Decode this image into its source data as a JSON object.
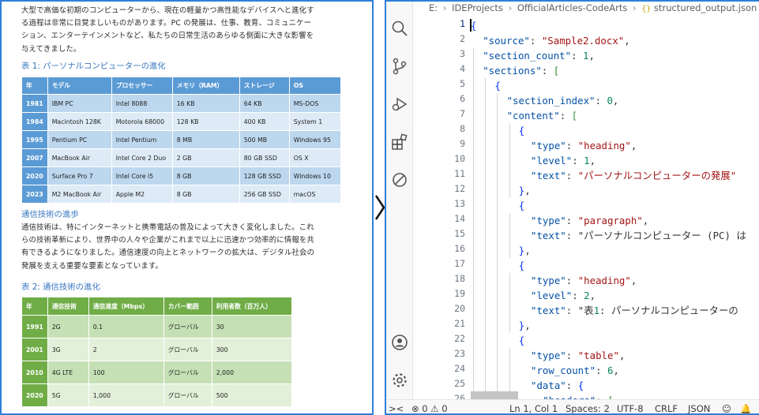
{
  "document": {
    "intro_lines": [
      "大型で高価な初期のコンピューターから、現在の軽量かつ高性能なデバイスへと進化す",
      "る過程は非常に目覚ましいものがあります。PC の発展は、仕事、教育、コミュニケー",
      "ション、エンターテインメントなど、私たちの日常生活のあらゆる側面に大きな影響を",
      "与えてきました。"
    ],
    "table1_caption": "表 1:  パーソナルコンピューターの進化",
    "table1": {
      "headers": [
        "年",
        "モデル",
        "プロセッサー",
        "メモリ（RAM）",
        "ストレージ",
        "OS"
      ],
      "rows": [
        [
          "1981",
          "IBM PC",
          "Intel 8088",
          "16 KB",
          "64 KB",
          "MS-DOS"
        ],
        [
          "1984",
          "Macintosh 128K",
          "Motorola 68000",
          "128 KB",
          "400 KB",
          "System 1"
        ],
        [
          "1995",
          "Pentium PC",
          "Intel Pentium",
          "8 MB",
          "500 MB",
          "Windows 95"
        ],
        [
          "2007",
          "MacBook Air",
          "Intel Core 2 Duo",
          "2 GB",
          "80 GB SSD",
          "OS X"
        ],
        [
          "2020",
          "Surface Pro 7",
          "Intel Core i5",
          "8 GB",
          "128 GB SSD",
          "Windows 10"
        ],
        [
          "2023",
          "M2 MacBook Air",
          "Apple M2",
          "8 GB",
          "256 GB SSD",
          "macOS"
        ]
      ]
    },
    "section2_heading": "通信技術の進歩",
    "section2_lines": [
      "通信技術は、特にインターネットと携帯電話の普及によって大きく変化しました。これ",
      "らの技術革新により、世界中の人々や企業がこれまで以上に迅速かつ効率的に情報を共",
      "有できるようになりました。通信速度の向上とネットワークの拡大は、デジタル社会の",
      "発展を支える重要な要素となっています。"
    ],
    "table2_caption": "表 2:  通信技術の進化",
    "table2": {
      "headers": [
        "年",
        "通信技術",
        "通信速度（Mbps）",
        "カバー範囲",
        "利用者数（百万人）"
      ],
      "rows": [
        [
          "1991",
          "2G",
          "0.1",
          "グローバル",
          "30"
        ],
        [
          "2001",
          "3G",
          "2",
          "グローバル",
          "300"
        ],
        [
          "2010",
          "4G LTE",
          "100",
          "グローバル",
          "2,000"
        ],
        [
          "2020",
          "5G",
          "1,000",
          "グローバル",
          "500"
        ]
      ]
    }
  },
  "editor": {
    "breadcrumb": [
      "E:",
      "IDEProjects",
      "OfficialArticles-CodeArts",
      "structured_output.json"
    ],
    "json_icon": "{}",
    "line_numbers": [
      "1",
      "2",
      "3",
      "4",
      "5",
      "6",
      "7",
      "8",
      "9",
      "10",
      "11",
      "12",
      "13",
      "14",
      "15",
      "16",
      "17",
      "18",
      "19",
      "20",
      "21",
      "22",
      "23",
      "24",
      "25",
      "26"
    ],
    "code_lines": [
      "{",
      "\"source\": \"Sample2.docx\",",
      "\"section_count\": 1,",
      "\"sections\": [",
      "{",
      "\"section_index\": 0,",
      "\"content\": [",
      "{",
      "\"type\": \"heading\",",
      "\"level\": 1,",
      "\"text\": \"パーソナルコンピューターの発展\"",
      "},",
      "{",
      "\"type\": \"paragraph\",",
      "\"text\": \"パーソナルコンピューター (PC) は",
      "},",
      "{",
      "\"type\": \"heading\",",
      "\"level\": 2,",
      "\"text\": \"表1: パーソナルコンピューターの",
      "},",
      "{",
      "\"type\": \"table\",",
      "\"row_count\": 6,",
      "\"data\": {",
      "\"headers\": ["
    ],
    "status": {
      "remote": "><",
      "errors": "0",
      "warnings": "0",
      "position": "Ln 1, Col 1",
      "spaces": "Spaces: 2",
      "encoding": "UTF-8",
      "eol": "CRLF",
      "language": "JSON"
    }
  }
}
